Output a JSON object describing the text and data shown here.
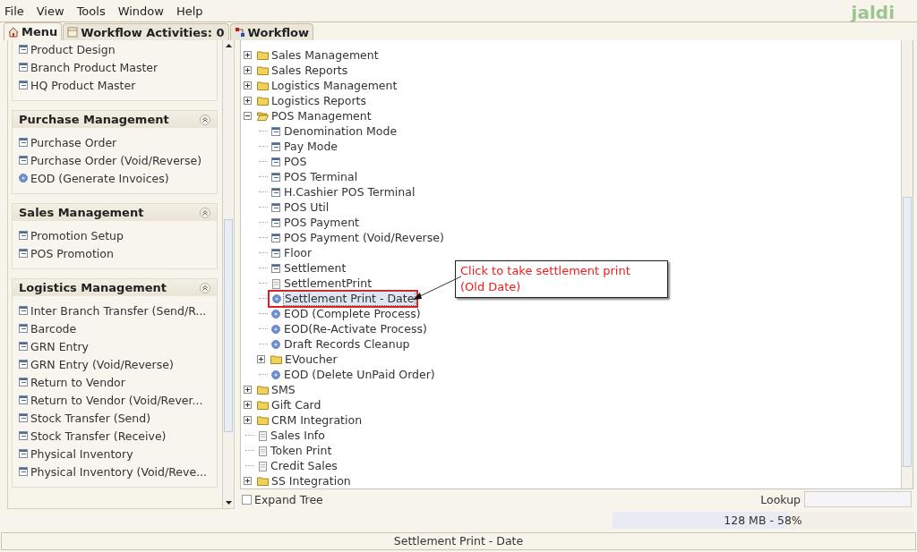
{
  "menu_bar": {
    "items": [
      "File",
      "View",
      "Tools",
      "Window",
      "Help"
    ],
    "logo": "jaldi"
  },
  "tabs": [
    {
      "label": "Menu",
      "selected": true
    },
    {
      "label": "Workflow Activities: 0",
      "selected": false
    },
    {
      "label": "Workflow",
      "selected": false
    }
  ],
  "side_panel": {
    "groups": [
      {
        "items": [
          {
            "label": "Product Design",
            "kind": "form"
          },
          {
            "label": "Branch Product Master",
            "kind": "form"
          },
          {
            "label": "HQ Product Master",
            "kind": "form"
          }
        ]
      },
      {
        "title": "Purchase Management",
        "items": [
          {
            "label": "Purchase Order",
            "kind": "form"
          },
          {
            "label": "Purchase Order (Void/Reverse)",
            "kind": "form"
          },
          {
            "label": "EOD (Generate Invoices)",
            "kind": "process"
          }
        ]
      },
      {
        "title": "Sales Management",
        "items": [
          {
            "label": "Promotion Setup",
            "kind": "form"
          },
          {
            "label": "POS Promotion",
            "kind": "form"
          }
        ]
      },
      {
        "title": "Logistics Management",
        "items": [
          {
            "label": "Inter Branch Transfer (Send/R...",
            "kind": "form"
          },
          {
            "label": "Barcode",
            "kind": "form"
          },
          {
            "label": "GRN Entry",
            "kind": "form"
          },
          {
            "label": "GRN Entry (Void/Reverse)",
            "kind": "form"
          },
          {
            "label": "Return to Vendor",
            "kind": "form"
          },
          {
            "label": "Return to Vendor (Void/Rever...",
            "kind": "form"
          },
          {
            "label": "Stock Transfer (Send)",
            "kind": "form"
          },
          {
            "label": "Stock Transfer (Receive)",
            "kind": "form"
          },
          {
            "label": "Physical Inventory",
            "kind": "form"
          },
          {
            "label": "Physical Inventory (Void/Reve...",
            "kind": "form"
          }
        ]
      }
    ]
  },
  "menu_tree": {
    "nodes": [
      {
        "label": "Sales Management",
        "kind": "folder",
        "expanded": false,
        "selected": false
      },
      {
        "label": "Sales Reports",
        "kind": "folder",
        "expanded": false,
        "selected": false
      },
      {
        "label": "Logistics Management",
        "kind": "folder",
        "expanded": false,
        "selected": false
      },
      {
        "label": "Logistics Reports",
        "kind": "folder",
        "expanded": false,
        "selected": false
      },
      {
        "label": "POS Management",
        "kind": "folder",
        "expanded": true,
        "selected": false,
        "children": [
          {
            "label": "Denomination Mode",
            "kind": "form",
            "selected": false
          },
          {
            "label": "Pay Mode",
            "kind": "form",
            "selected": false
          },
          {
            "label": "POS",
            "kind": "form",
            "selected": false
          },
          {
            "label": "POS Terminal",
            "kind": "form",
            "selected": false
          },
          {
            "label": "H.Cashier POS Terminal",
            "kind": "form",
            "selected": false
          },
          {
            "label": "POS Util",
            "kind": "form",
            "selected": false
          },
          {
            "label": "POS Payment",
            "kind": "form",
            "selected": false
          },
          {
            "label": "POS Payment (Void/Reverse)",
            "kind": "form",
            "selected": false
          },
          {
            "label": "Floor",
            "kind": "form",
            "selected": false
          },
          {
            "label": "Settlement",
            "kind": "form",
            "selected": false
          },
          {
            "label": "SettlementPrint",
            "kind": "report",
            "selected": false
          },
          {
            "label": "Settlement Print - Date",
            "kind": "process",
            "selected": true
          },
          {
            "label": "EOD (Complete Process)",
            "kind": "process",
            "selected": false
          },
          {
            "label": "EOD(Re-Activate Process)",
            "kind": "process",
            "selected": false
          },
          {
            "label": "Draft Records Cleanup",
            "kind": "process",
            "selected": false
          },
          {
            "label": "EVoucher",
            "kind": "folder",
            "expanded": false,
            "selected": false
          },
          {
            "label": "EOD (Delete UnPaid Order)",
            "kind": "process",
            "selected": false
          }
        ]
      },
      {
        "label": "SMS",
        "kind": "folder",
        "expanded": false,
        "selected": false
      },
      {
        "label": "Gift Card",
        "kind": "folder",
        "expanded": false,
        "selected": false
      },
      {
        "label": "CRM Integration",
        "kind": "folder",
        "expanded": false,
        "selected": false
      },
      {
        "label": "Sales Info",
        "kind": "report",
        "selected": false
      },
      {
        "label": "Token Print",
        "kind": "report",
        "selected": false
      },
      {
        "label": "Credit Sales",
        "kind": "report",
        "selected": false
      },
      {
        "label": "SS Integration",
        "kind": "folder",
        "expanded": false,
        "selected": false
      }
    ]
  },
  "callout": {
    "lines": [
      "Click to take settlement print",
      "(Old Date)"
    ]
  },
  "expand_tree": {
    "label": "Expand Tree",
    "checked": false
  },
  "lookup": {
    "label": "Lookup"
  },
  "memory": {
    "text": "128 MB - 58%",
    "level": 0.58
  },
  "status_bar": {
    "text": "Settlement Print - Date"
  }
}
